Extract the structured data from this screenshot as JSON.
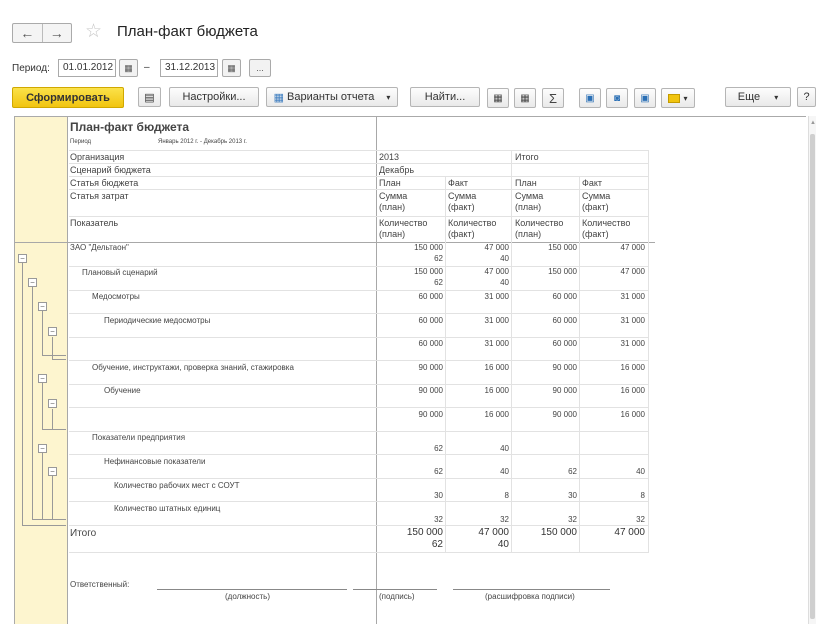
{
  "window": {
    "title": "План-факт бюджета",
    "back_glyph": "←",
    "fwd_glyph": "→",
    "star_glyph": "☆"
  },
  "period": {
    "label": "Период:",
    "from": "01.01.2012",
    "to": "31.12.2013",
    "dash": "–",
    "calendar_glyph": "▦",
    "more_glyph": "..."
  },
  "toolbar": {
    "generate": "Сформировать",
    "settings": "Настройки...",
    "variants": "Варианты отчета",
    "find": "Найти...",
    "more": "Еще",
    "help": "?",
    "dropdown_glyph": "▾",
    "sigma": "Σ",
    "print_glyph": "🖶",
    "preview_glyph": "🔍",
    "save_glyph": "💾",
    "sheet_glyph": "▤"
  },
  "colors": {
    "accent": "#f1c40f",
    "tree_bg": "#fdf5cf"
  },
  "report": {
    "title": "План-факт бюджета",
    "period_label": "Период",
    "period_value": "Январь 2012 г. - Декабрь 2013 г.",
    "headers": [
      "Организация",
      "Сценарий бюджета",
      "Статья бюджета",
      "Статья затрат",
      "Показатель"
    ],
    "year": "2013",
    "month": "Декабрь",
    "total_label": "Итого",
    "plan": "План",
    "fact": "Факт",
    "sum_plan": "Сумма\n(план)",
    "sum_fact": "Сумма\n(факт)",
    "qty_plan": "Количество\n(план)",
    "qty_fact": "Количество\n(факт)",
    "rows": [
      {
        "label": "ЗАО \"Дельтаон\"",
        "vals": [
          "150 000",
          "47 000",
          "150 000",
          "47 000"
        ],
        "qty": [
          "62",
          "40",
          "",
          ""
        ]
      },
      {
        "label": "Плановый сценарий",
        "vals": [
          "150 000",
          "47 000",
          "150 000",
          "47 000"
        ],
        "qty": [
          "62",
          "40",
          "",
          ""
        ]
      },
      {
        "label": "Медосмотры",
        "vals": [
          "60 000",
          "31 000",
          "60 000",
          "31 000"
        ]
      },
      {
        "label": "Периодические медосмотры",
        "vals": [
          "60 000",
          "31 000",
          "60 000",
          "31 000"
        ]
      },
      {
        "label": "",
        "vals": [
          "60 000",
          "31 000",
          "60 000",
          "31 000"
        ]
      },
      {
        "label": "Обучение, инструктажи, проверка знаний, стажировка",
        "vals": [
          "90 000",
          "16 000",
          "90 000",
          "16 000"
        ]
      },
      {
        "label": "Обучение",
        "vals": [
          "90 000",
          "16 000",
          "90 000",
          "16 000"
        ]
      },
      {
        "label": "",
        "vals": [
          "90 000",
          "16 000",
          "90 000",
          "16 000"
        ]
      },
      {
        "label": "Показатели предприятия",
        "vals": [
          "62",
          "40",
          "",
          ""
        ]
      },
      {
        "label": "Нефинансовые показатели",
        "vals": [
          "62",
          "40",
          "62",
          "40"
        ]
      },
      {
        "label": "Количество рабочих мест с СОУТ",
        "vals": [
          "30",
          "8",
          "30",
          "8"
        ]
      },
      {
        "label": "Количество штатных единиц",
        "vals": [
          "32",
          "32",
          "32",
          "32"
        ]
      }
    ],
    "total": {
      "vals": [
        "150 000",
        "47 000",
        "150 000",
        "47 000"
      ],
      "qty": [
        "62",
        "40"
      ]
    },
    "signature": {
      "label": "Ответственный:",
      "position": "(должность)",
      "sign": "(подпись)",
      "decode": "(расшифровка подписи)"
    },
    "collapse_glyph": "⊟"
  }
}
